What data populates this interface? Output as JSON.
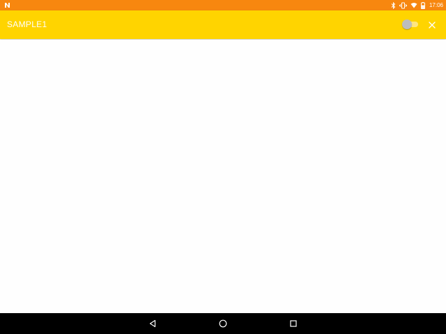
{
  "status_bar": {
    "time": "17:06",
    "background_color": "#f7870f",
    "icons": [
      "notification-n-icon",
      "bluetooth-icon",
      "vibrate-icon",
      "wifi-icon",
      "battery-icon"
    ]
  },
  "app_bar": {
    "title": "SAMPLE1",
    "background_color": "#ffd400",
    "toggle": {
      "checked": false
    },
    "close_icon": "close-icon"
  },
  "nav_bar": {
    "icons": [
      "back-icon",
      "home-icon",
      "recents-icon"
    ]
  }
}
